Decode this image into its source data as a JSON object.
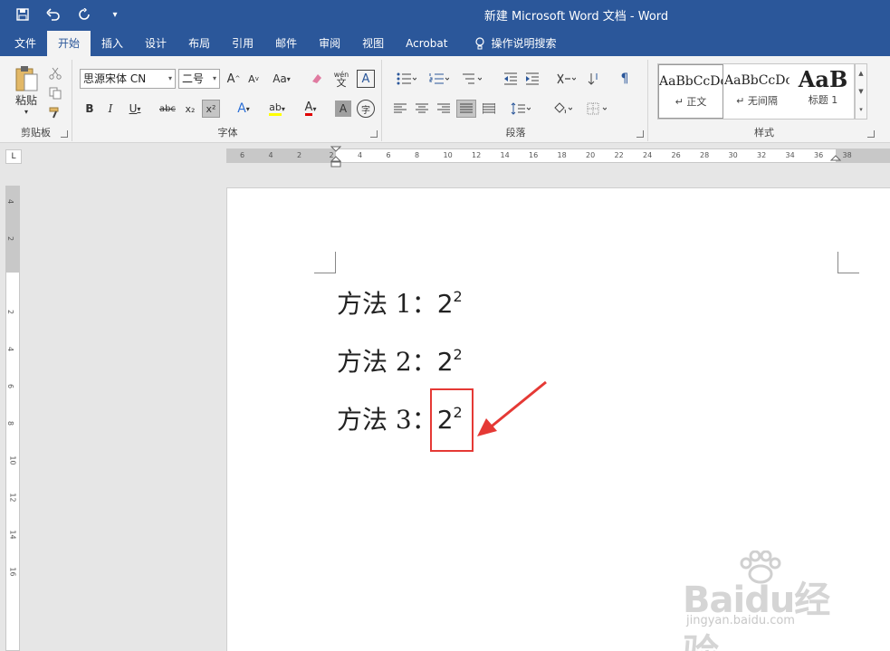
{
  "titlebar": {
    "title": "新建 Microsoft Word 文档 - Word",
    "qat": [
      {
        "name": "save-icon",
        "glyph": "🖫"
      },
      {
        "name": "undo-icon",
        "glyph": "↶"
      },
      {
        "name": "redo-icon",
        "glyph": "↻"
      },
      {
        "name": "customize-qat-icon",
        "glyph": "▾"
      }
    ]
  },
  "tabs": [
    {
      "label": "文件",
      "active": false
    },
    {
      "label": "开始",
      "active": true
    },
    {
      "label": "插入",
      "active": false
    },
    {
      "label": "设计",
      "active": false
    },
    {
      "label": "布局",
      "active": false
    },
    {
      "label": "引用",
      "active": false
    },
    {
      "label": "邮件",
      "active": false
    },
    {
      "label": "审阅",
      "active": false
    },
    {
      "label": "视图",
      "active": false
    },
    {
      "label": "Acrobat",
      "active": false
    }
  ],
  "tell_me": "操作说明搜索",
  "ribbon": {
    "clipboard": {
      "paste": "粘贴",
      "label": "剪贴板"
    },
    "font": {
      "name": "思源宋体 CN",
      "size": "二号",
      "label": "字体",
      "bold": "B",
      "italic": "I",
      "underline": "U",
      "strike": "abc",
      "subscript": "x₂",
      "superscript": "x²",
      "grow": "A",
      "shrink": "A",
      "case": "Aa",
      "effects": "A",
      "highlight": "ab",
      "color": "A",
      "shade": "A",
      "enclose": "字",
      "phonetic": "wén",
      "border": "A"
    },
    "paragraph": {
      "label": "段落"
    },
    "styles": {
      "label": "样式",
      "items": [
        {
          "preview": "AaBbCcDc",
          "name": "↵ 正文",
          "selected": true
        },
        {
          "preview": "AaBbCcDc",
          "name": "↵ 无间隔",
          "selected": false
        },
        {
          "preview": "AaB",
          "name": "标题 1",
          "selected": false
        }
      ]
    }
  },
  "ruler_h": [
    "6",
    "4",
    "2",
    "2",
    "4",
    "6",
    "8",
    "10",
    "12",
    "14",
    "16",
    "18",
    "20",
    "22",
    "24",
    "26",
    "28",
    "30",
    "32",
    "34",
    "36",
    "38"
  ],
  "ruler_v": [
    "4",
    "2",
    "2",
    "4",
    "6",
    "8",
    "10",
    "12",
    "14",
    "16"
  ],
  "document": {
    "lines": [
      {
        "prefix": "方法 1：",
        "base": "2",
        "sup": "2"
      },
      {
        "prefix": "方法 2：",
        "base": "2",
        "sup": "2"
      },
      {
        "prefix": "方法 3：",
        "base": "2",
        "sup": "2"
      }
    ]
  },
  "watermark": {
    "main": "Baidu经验",
    "sub": "jingyan.baidu.com"
  },
  "colors": {
    "brand": "#2b579a",
    "annotation": "#e53935"
  }
}
